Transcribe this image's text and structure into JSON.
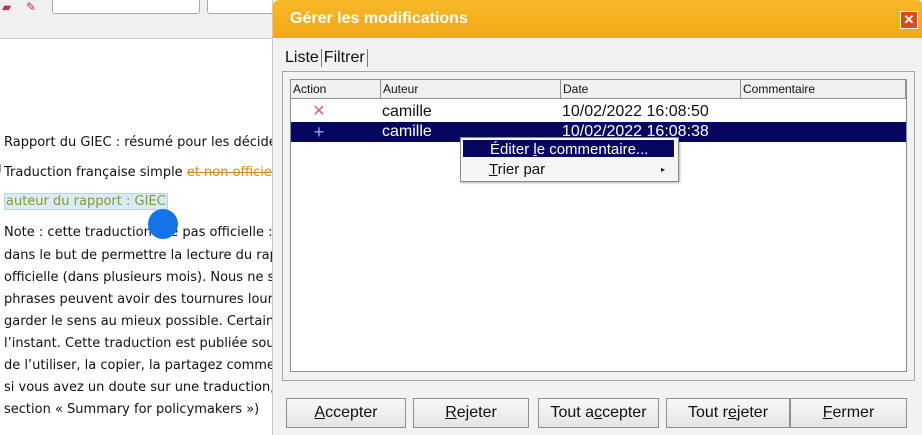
{
  "document": {
    "lines": [
      "Rapport du GIEC : résumé pour les décideurs",
      "Traduction française simple",
      "et non officielle",
      "auteur du rapport : GIEC",
      "Note : cette traduction n",
      "e pas officielle : c’",
      "dans le but de permettre la lecture du rappor",
      "officielle (dans plusieurs mois). Nous ne somr",
      "phrases peuvent avoir des tournures lourdes",
      "garder le sens au mieux possible. Certaines n",
      "l’instant. Cette traduction est publiée sous lic",
      "de l’utiliser, la copier, la partagez comme vou",
      "si vous avez un doute sur une traduction, voi",
      "section « Summary for policymakers »)"
    ]
  },
  "dialog": {
    "title": "Gérer les modifications",
    "close_label": "✕",
    "tabs": [
      "Liste",
      "Filtrer"
    ],
    "columns": [
      "Action",
      "Auteur",
      "Date",
      "Commentaire"
    ],
    "rows": [
      {
        "action_icon": "reject-x-icon",
        "action_glyph": "✕",
        "author": "camille",
        "date": "10/02/2022 16:08:50",
        "comment": ""
      },
      {
        "action_icon": "insert-plus-icon",
        "action_glyph": "+",
        "author": "camille",
        "date": "10/02/2022 16:08:38",
        "comment": ""
      }
    ],
    "context_menu": {
      "edit_prefix": "Éditer ",
      "edit_mnemonic": "l",
      "edit_suffix": "e commentaire...",
      "sort_mnemonic": "T",
      "sort_suffix": "rier par",
      "sort_arrow": "▸"
    },
    "buttons": {
      "accept": {
        "m": "A",
        "rest": "ccepter"
      },
      "reject": {
        "m": "R",
        "rest": "ejeter"
      },
      "accept_all": {
        "pre": "Tout a",
        "m": "c",
        "rest": "cepter"
      },
      "reject_all": {
        "pre": "Tout r",
        "m": "e",
        "rest": "jeter"
      },
      "close": {
        "m": "F",
        "rest": "ermer"
      }
    }
  },
  "colors": {
    "title_bar": "#f3a716",
    "selection": "#07075f",
    "reject_icon": "#e06080",
    "insert_icon": "#7fb0ff"
  }
}
